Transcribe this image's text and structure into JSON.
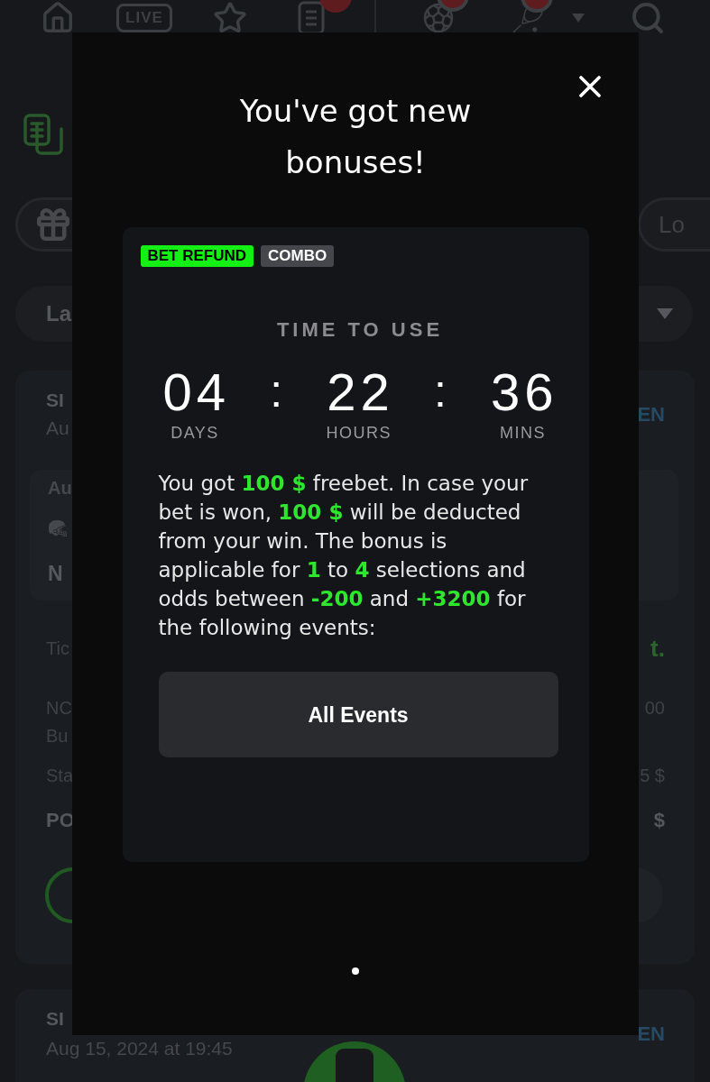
{
  "backdrop": {
    "top_nav": {
      "live_label": "LIVE"
    },
    "filter_pill": {
      "label": "Lo"
    },
    "dropdown": {
      "value": "La"
    },
    "bet_cards": [
      {
        "heading": "SI",
        "subheading": "Au",
        "side_label": "EN",
        "event": {
          "line_1": "Au",
          "line_2": "N"
        },
        "rows": [
          {
            "kind": "brand",
            "label": "Tic",
            "value": "t."
          },
          {
            "kind": "selection",
            "label": "NC",
            "sublabel": "Bu",
            "value": "00"
          },
          {
            "kind": "plain",
            "label": "Sta",
            "value": "5 $"
          },
          {
            "kind": "bold",
            "label": "PO",
            "value": "$"
          }
        ]
      },
      {
        "heading": "SI",
        "subheading": "Aug 15, 2024 at 19:45",
        "side_label": "EN"
      }
    ]
  },
  "modal": {
    "title": "You've got new bonuses!",
    "bonus": {
      "tags": [
        {
          "label": "BET REFUND",
          "color": "#14f014"
        },
        {
          "label": "COMBO",
          "color": "#45474c"
        }
      ],
      "timer_title": "TIME TO USE",
      "timer": [
        {
          "value": "04",
          "unit": "DAYS"
        },
        {
          "value": "22",
          "unit": "HOURS"
        },
        {
          "value": "36",
          "unit": "MINS"
        }
      ],
      "separators": [
        ":",
        ":"
      ],
      "description": "You got **100 $** freebet. In case your bet is won, **100 $** will be deducted from your win. The bonus is applicable for **1** to **4** selections and odds between **-200** and **+3200** for the following events:",
      "action": "All Events"
    },
    "pagination": [
      {
        "selected": true
      }
    ]
  }
}
